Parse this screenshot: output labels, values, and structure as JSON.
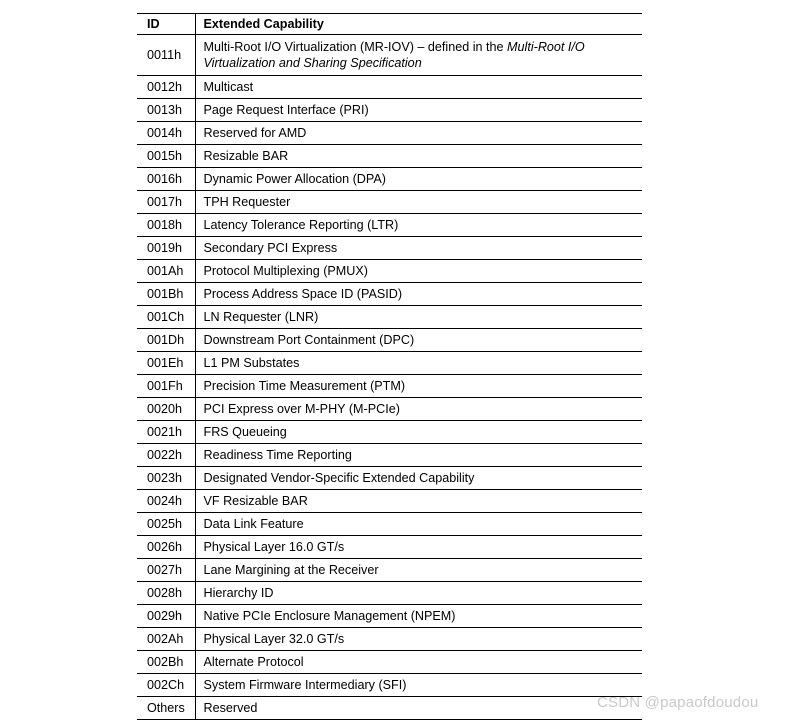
{
  "table": {
    "headers": {
      "id": "ID",
      "capability": "Extended Capability"
    },
    "rows": [
      {
        "id": "0011h",
        "capability": "Multi-Root I/O Virtualization (MR-IOV) – defined in the ",
        "capability_italic": "Multi-Root I/O Virtualization and Sharing Specification",
        "tall": true
      },
      {
        "id": "0012h",
        "capability": "Multicast"
      },
      {
        "id": "0013h",
        "capability": "Page Request Interface (PRI)"
      },
      {
        "id": "0014h",
        "capability": "Reserved for AMD"
      },
      {
        "id": "0015h",
        "capability": "Resizable BAR"
      },
      {
        "id": "0016h",
        "capability": "Dynamic Power Allocation (DPA)"
      },
      {
        "id": "0017h",
        "capability": "TPH Requester"
      },
      {
        "id": "0018h",
        "capability": "Latency Tolerance Reporting (LTR)"
      },
      {
        "id": "0019h",
        "capability": "Secondary PCI Express"
      },
      {
        "id": "001Ah",
        "capability": "Protocol Multiplexing (PMUX)"
      },
      {
        "id": "001Bh",
        "capability": "Process Address Space ID (PASID)"
      },
      {
        "id": "001Ch",
        "capability": "LN Requester (LNR)"
      },
      {
        "id": "001Dh",
        "capability": "Downstream Port Containment (DPC)"
      },
      {
        "id": "001Eh",
        "capability": "L1 PM Substates"
      },
      {
        "id": "001Fh",
        "capability": "Precision Time Measurement (PTM)"
      },
      {
        "id": "0020h",
        "capability": "PCI Express over M-PHY (M-PCIe)"
      },
      {
        "id": "0021h",
        "capability": "FRS Queueing"
      },
      {
        "id": "0022h",
        "capability": "Readiness Time Reporting"
      },
      {
        "id": "0023h",
        "capability": "Designated Vendor-Specific Extended Capability"
      },
      {
        "id": "0024h",
        "capability": "VF Resizable BAR"
      },
      {
        "id": "0025h",
        "capability": "Data Link Feature"
      },
      {
        "id": "0026h",
        "capability": "Physical Layer 16.0 GT/s"
      },
      {
        "id": "0027h",
        "capability": "Lane Margining at the Receiver"
      },
      {
        "id": "0028h",
        "capability": "Hierarchy ID"
      },
      {
        "id": "0029h",
        "capability": "Native PCIe Enclosure Management (NPEM)"
      },
      {
        "id": "002Ah",
        "capability": "Physical Layer 32.0 GT/s"
      },
      {
        "id": "002Bh",
        "capability": "Alternate Protocol"
      },
      {
        "id": "002Ch",
        "capability": "System Firmware Intermediary (SFI)"
      },
      {
        "id": "Others",
        "capability": "Reserved"
      }
    ]
  },
  "watermark": {
    "text": "CSDN @papaofdoudou"
  },
  "colors": {
    "text": "#000000",
    "border": "#000000",
    "background": "#ffffff",
    "watermark": "#c9c9c9"
  }
}
